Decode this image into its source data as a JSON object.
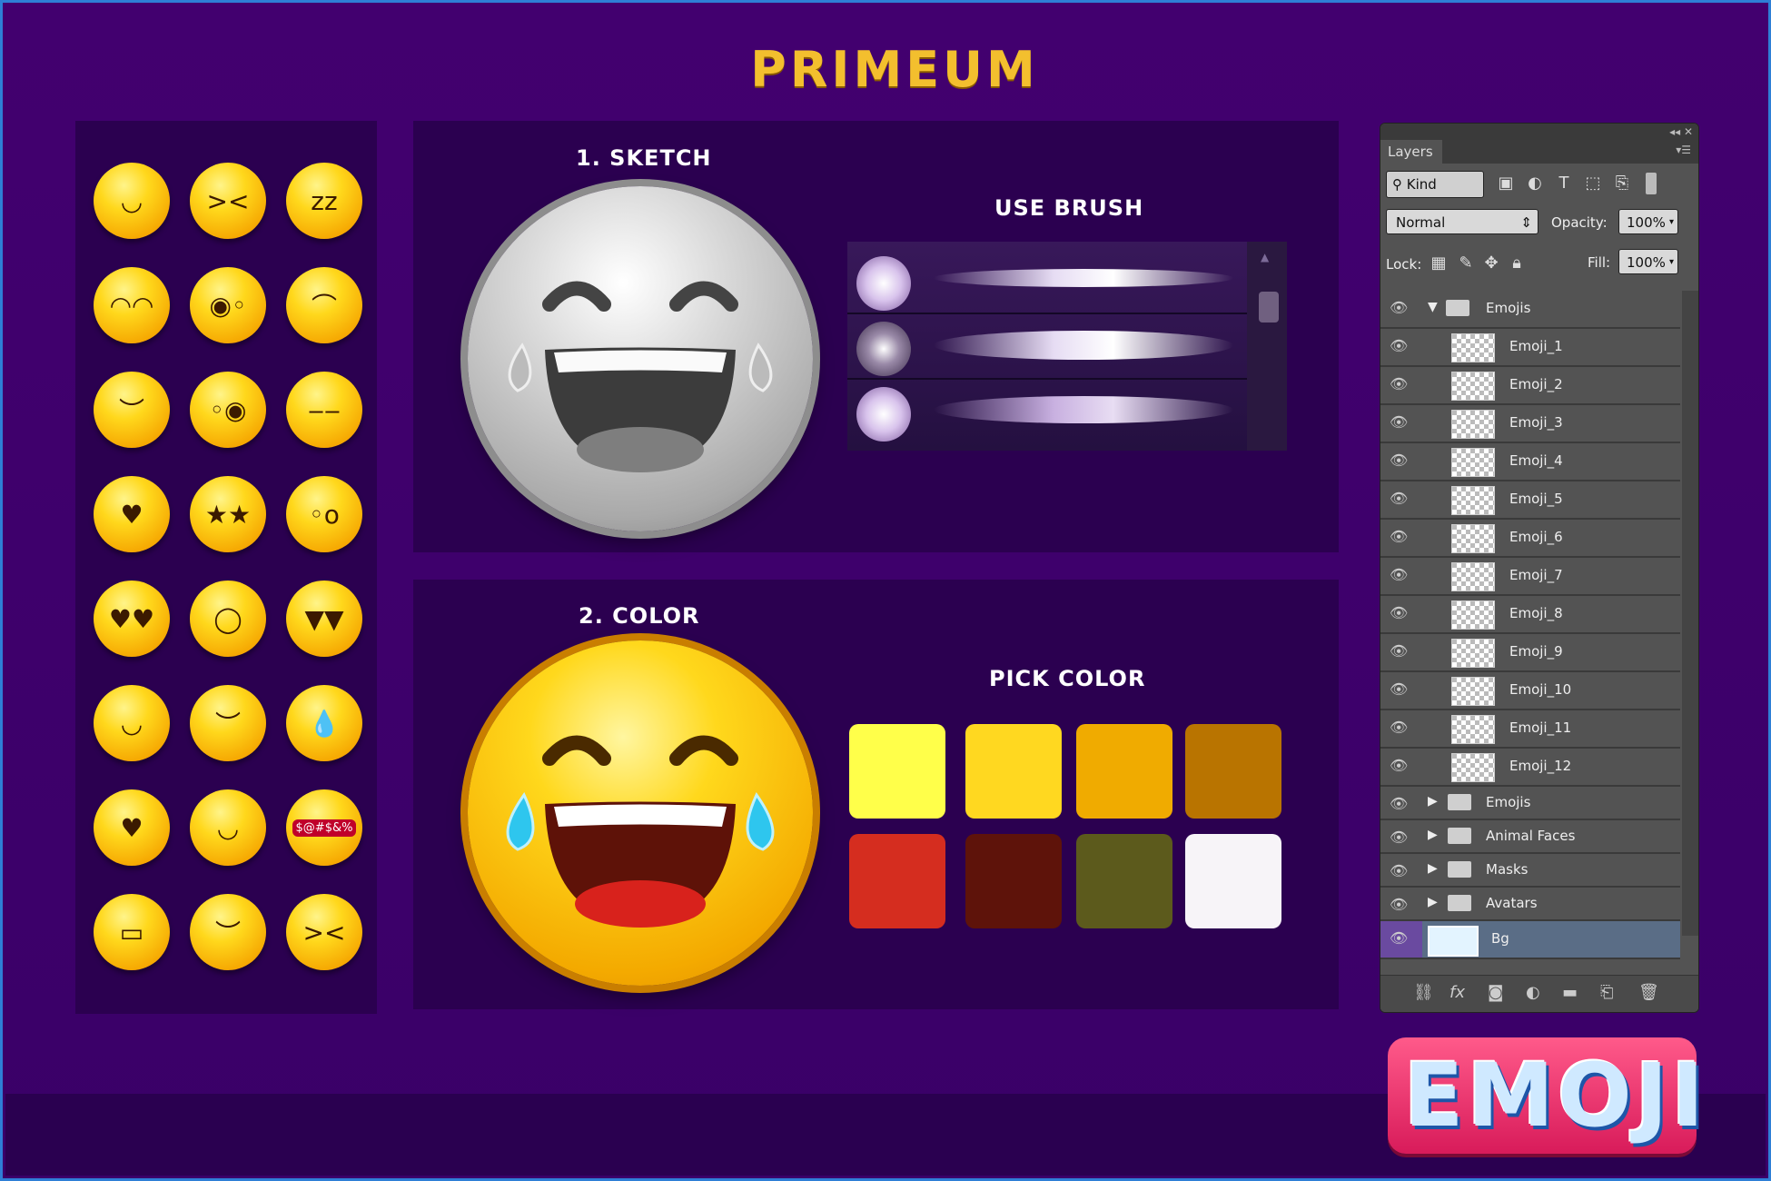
{
  "title": "PRIMEUM",
  "emoji_sheet": {
    "rows": [
      [
        "smiling-face",
        "squinting-tongue",
        "sleeping-face"
      ],
      [
        "tears-of-joy",
        "zany-face",
        "winking-face"
      ],
      [
        "relieved-face",
        "winking-tongue",
        "unamused-face"
      ],
      [
        "smiling-hearts",
        "star-struck",
        "astonished-face"
      ],
      [
        "heart-eyes",
        "halo-face",
        "angry-face"
      ],
      [
        "tongue-face",
        "content-face",
        "hot-face"
      ],
      [
        "kissing-heart",
        "smirk-face",
        "cursing-face"
      ],
      [
        "grimacing-face",
        "sleepy-face",
        "squinting-tongue-2"
      ]
    ],
    "cursing_text": "$@#$&%"
  },
  "sketch": {
    "title": "1. SKETCH",
    "brush_title": "USE BRUSH"
  },
  "color": {
    "title": "2. COLOR",
    "pick_title": "PICK COLOR",
    "swatches": [
      "#ffff4a",
      "#ffd820",
      "#f0ab00",
      "#b97400",
      "#d52d1f",
      "#5e130a",
      "#5c5a1c",
      "#f7f4f8"
    ]
  },
  "layers_panel": {
    "tab": "Layers",
    "filter_label": "Kind",
    "blend_mode": "Normal",
    "opacity_label": "Opacity:",
    "opacity_value": "100%",
    "lock_label": "Lock:",
    "fill_label": "Fill:",
    "fill_value": "100%",
    "open_group": "Emojis",
    "layers": [
      "Emoji_1",
      "Emoji_2",
      "Emoji_3",
      "Emoji_4",
      "Emoji_5",
      "Emoji_6",
      "Emoji_7",
      "Emoji_8",
      "Emoji_9",
      "Emoji_10",
      "Emoji_11",
      "Emoji_12"
    ],
    "groups": [
      "Emojis",
      "Animal Faces",
      "Masks",
      "Avatars"
    ],
    "background_layer": "Bg"
  },
  "logo_text": "EMOJI"
}
